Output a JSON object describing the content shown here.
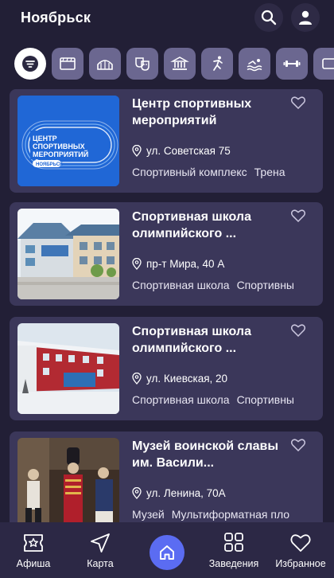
{
  "header": {
    "city": "Ноябрьск",
    "search_icon": "search-icon",
    "profile_icon": "user-icon"
  },
  "chips": [
    "filter-icon",
    "cinema-icon",
    "circus-icon",
    "theater-masks-icon",
    "museum-icon",
    "sport-icon",
    "swimming-icon",
    "fitness-icon",
    "more-icon"
  ],
  "cards": [
    {
      "title": "Центр спортивных мероприятий",
      "address": "ул. Советская 75",
      "tags": [
        "Спортивный комплекс",
        "Трена"
      ],
      "logo_lines": [
        "ЦЕНТР",
        "СПОРТИВНЫХ",
        "МЕРОПРИЯТИЙ"
      ],
      "logo_city": "НОЯБРЬСК"
    },
    {
      "title": "Спортивная школа олимпийского ...",
      "address": "пр-т Мира, 40 А",
      "tags": [
        "Спортивная школа",
        "Спортивны"
      ]
    },
    {
      "title": "Спортивная школа олимпийского ...",
      "address": "ул. Киевская, 20",
      "tags": [
        "Спортивная школа",
        "Спортивны"
      ]
    },
    {
      "title": "Музей воинской славы им. Васили...",
      "address": "ул. Ленина, 70А",
      "tags": [
        "Музей",
        "Мультиформатная пло"
      ]
    }
  ],
  "nav": {
    "afisha": "Афиша",
    "map": "Карта",
    "venues": "Заведения",
    "favorites": "Избранное"
  },
  "colors": {
    "background": "#221f36",
    "card": "#3b375a",
    "chip": "#6b6790",
    "accent": "#5b6cf2"
  }
}
